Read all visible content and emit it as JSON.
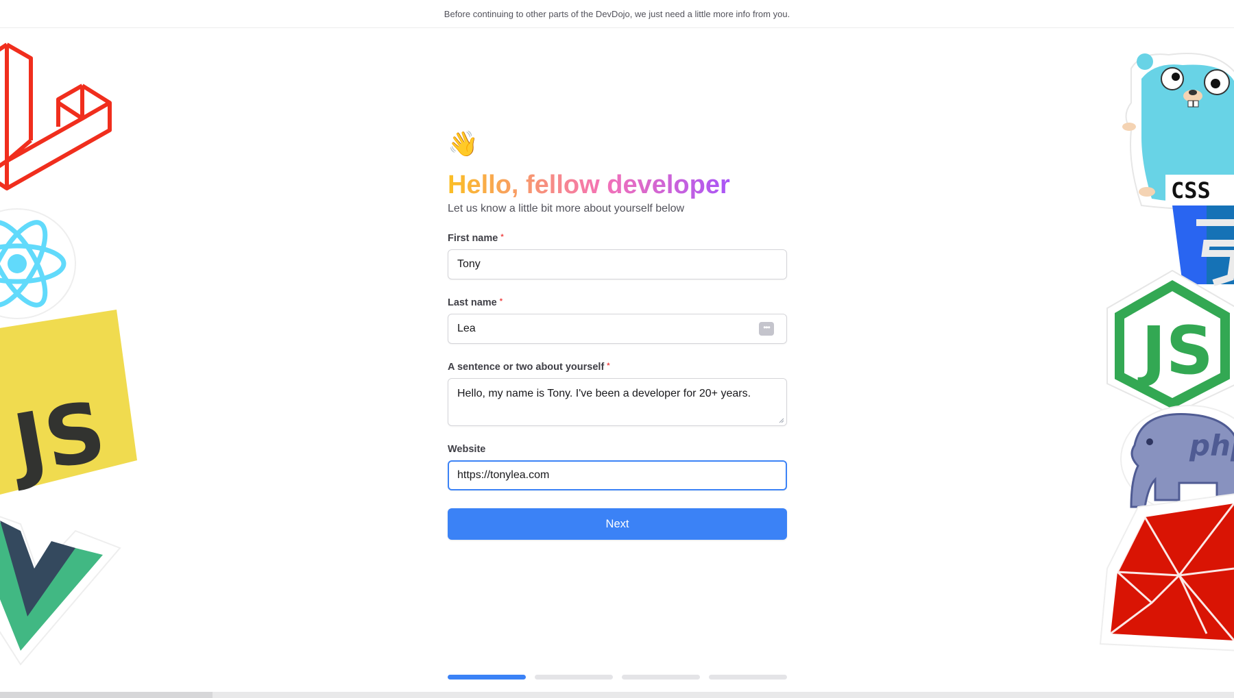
{
  "notice": "Before continuing to other parts of the DevDojo, we just need a little more info from you.",
  "form": {
    "wave_emoji": "👋",
    "title": "Hello, fellow developer",
    "subtitle": "Let us know a little bit more about yourself below",
    "required_mark": "*",
    "fields": {
      "first_name": {
        "label": "First name",
        "value": "Tony",
        "required": true
      },
      "last_name": {
        "label": "Last name",
        "value": "Lea",
        "required": true
      },
      "about": {
        "label": "A sentence or two about yourself",
        "value": "Hello, my name is Tony. I've been a developer for 20+ years.",
        "required": true
      },
      "website": {
        "label": "Website",
        "value": "https://tonylea.com",
        "required": false
      }
    },
    "next_label": "Next",
    "password_manager_icon": "ellipsis-key-icon"
  },
  "steps": {
    "total": 4,
    "current": 1
  },
  "stickers": {
    "left": [
      "laravel-logo",
      "react-logo",
      "javascript-logo",
      "vue-logo"
    ],
    "right": [
      "go-gopher-logo",
      "css3-logo",
      "nodejs-logo",
      "php-elephant-logo",
      "ruby-logo"
    ],
    "sticker_text": {
      "javascript": "JS",
      "css": "CSS",
      "node": "JS",
      "php": "php"
    }
  },
  "colors": {
    "accent": "#3b82f6",
    "required": "#ef4444",
    "title_gradient": [
      "#fbbf24",
      "#f472b6",
      "#a855f7"
    ]
  }
}
